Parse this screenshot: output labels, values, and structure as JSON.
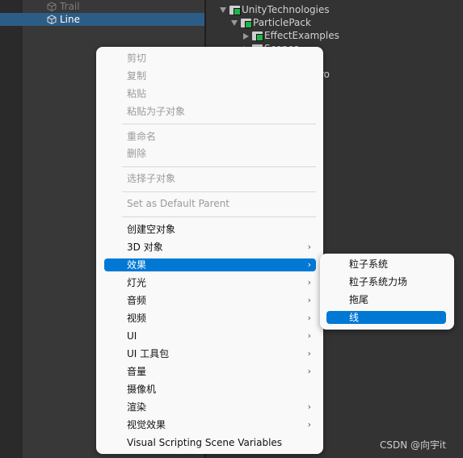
{
  "hierarchy": {
    "items": [
      {
        "label": "Trail",
        "state": "dimmed"
      },
      {
        "label": "Line",
        "state": "selected"
      }
    ]
  },
  "project": {
    "items": [
      "UnityTechnologies",
      "ParticlePack",
      "EffectExamples",
      "Scenes",
      "ro"
    ]
  },
  "menu": {
    "clipboard": [
      "剪切",
      "复制",
      "粘贴",
      "粘贴为子对象"
    ],
    "edit": [
      "重命名",
      "删除"
    ],
    "select_children": "选择子对象",
    "set_default_parent": "Set as Default Parent",
    "create": [
      {
        "label": "创建空对象",
        "submenu": false
      },
      {
        "label": "3D 对象",
        "submenu": true
      },
      {
        "label": "效果",
        "submenu": true,
        "highlighted": true
      },
      {
        "label": "灯光",
        "submenu": true
      },
      {
        "label": "音频",
        "submenu": true
      },
      {
        "label": "视频",
        "submenu": true
      },
      {
        "label": "UI",
        "submenu": true
      },
      {
        "label": "UI 工具包",
        "submenu": true
      },
      {
        "label": "音量",
        "submenu": true
      },
      {
        "label": "摄像机",
        "submenu": false
      },
      {
        "label": "渲染",
        "submenu": true
      },
      {
        "label": "视觉效果",
        "submenu": true
      },
      {
        "label": "Visual Scripting Scene Variables",
        "submenu": false
      }
    ],
    "arrow": "›"
  },
  "submenu": {
    "items": [
      "粒子系统",
      "粒子系统力场",
      "拖尾",
      "线"
    ],
    "highlighted": "线"
  },
  "watermark": "CSDN @向宇it",
  "colors": {
    "highlight": "#0078d4",
    "selection": "#2c5d87"
  }
}
